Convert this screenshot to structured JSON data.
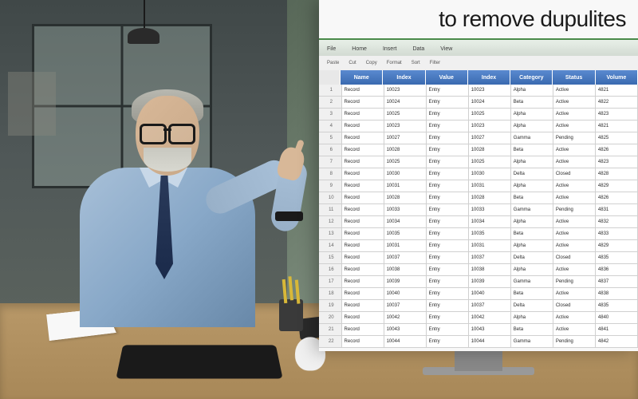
{
  "screen": {
    "title": "to remove dupulites",
    "ribbon_tabs": [
      "File",
      "Home",
      "Insert",
      "Data",
      "View"
    ],
    "toolbar_items": [
      "Paste",
      "Cut",
      "Copy",
      "Format",
      "Sort",
      "Filter"
    ],
    "columns": [
      "",
      "Name",
      "Index",
      "Value",
      "Index",
      "Category",
      "Status",
      "Volume"
    ],
    "rows": [
      [
        "1",
        "Record",
        "10023",
        "Entry",
        "10023",
        "Alpha",
        "Active",
        "4821"
      ],
      [
        "2",
        "Record",
        "10024",
        "Entry",
        "10024",
        "Beta",
        "Active",
        "4822"
      ],
      [
        "3",
        "Record",
        "10025",
        "Entry",
        "10025",
        "Alpha",
        "Active",
        "4823"
      ],
      [
        "4",
        "Record",
        "10023",
        "Entry",
        "10023",
        "Alpha",
        "Active",
        "4821"
      ],
      [
        "5",
        "Record",
        "10027",
        "Entry",
        "10027",
        "Gamma",
        "Pending",
        "4825"
      ],
      [
        "6",
        "Record",
        "10028",
        "Entry",
        "10028",
        "Beta",
        "Active",
        "4826"
      ],
      [
        "7",
        "Record",
        "10025",
        "Entry",
        "10025",
        "Alpha",
        "Active",
        "4823"
      ],
      [
        "8",
        "Record",
        "10030",
        "Entry",
        "10030",
        "Delta",
        "Closed",
        "4828"
      ],
      [
        "9",
        "Record",
        "10031",
        "Entry",
        "10031",
        "Alpha",
        "Active",
        "4829"
      ],
      [
        "10",
        "Record",
        "10028",
        "Entry",
        "10028",
        "Beta",
        "Active",
        "4826"
      ],
      [
        "11",
        "Record",
        "10033",
        "Entry",
        "10033",
        "Gamma",
        "Pending",
        "4831"
      ],
      [
        "12",
        "Record",
        "10034",
        "Entry",
        "10034",
        "Alpha",
        "Active",
        "4832"
      ],
      [
        "13",
        "Record",
        "10035",
        "Entry",
        "10035",
        "Beta",
        "Active",
        "4833"
      ],
      [
        "14",
        "Record",
        "10031",
        "Entry",
        "10031",
        "Alpha",
        "Active",
        "4829"
      ],
      [
        "15",
        "Record",
        "10037",
        "Entry",
        "10037",
        "Delta",
        "Closed",
        "4835"
      ],
      [
        "16",
        "Record",
        "10038",
        "Entry",
        "10038",
        "Alpha",
        "Active",
        "4836"
      ],
      [
        "17",
        "Record",
        "10039",
        "Entry",
        "10039",
        "Gamma",
        "Pending",
        "4837"
      ],
      [
        "18",
        "Record",
        "10040",
        "Entry",
        "10040",
        "Beta",
        "Active",
        "4838"
      ],
      [
        "19",
        "Record",
        "10037",
        "Entry",
        "10037",
        "Delta",
        "Closed",
        "4835"
      ],
      [
        "20",
        "Record",
        "10042",
        "Entry",
        "10042",
        "Alpha",
        "Active",
        "4840"
      ],
      [
        "21",
        "Record",
        "10043",
        "Entry",
        "10043",
        "Beta",
        "Active",
        "4841"
      ],
      [
        "22",
        "Record",
        "10044",
        "Entry",
        "10044",
        "Gamma",
        "Pending",
        "4842"
      ]
    ]
  }
}
